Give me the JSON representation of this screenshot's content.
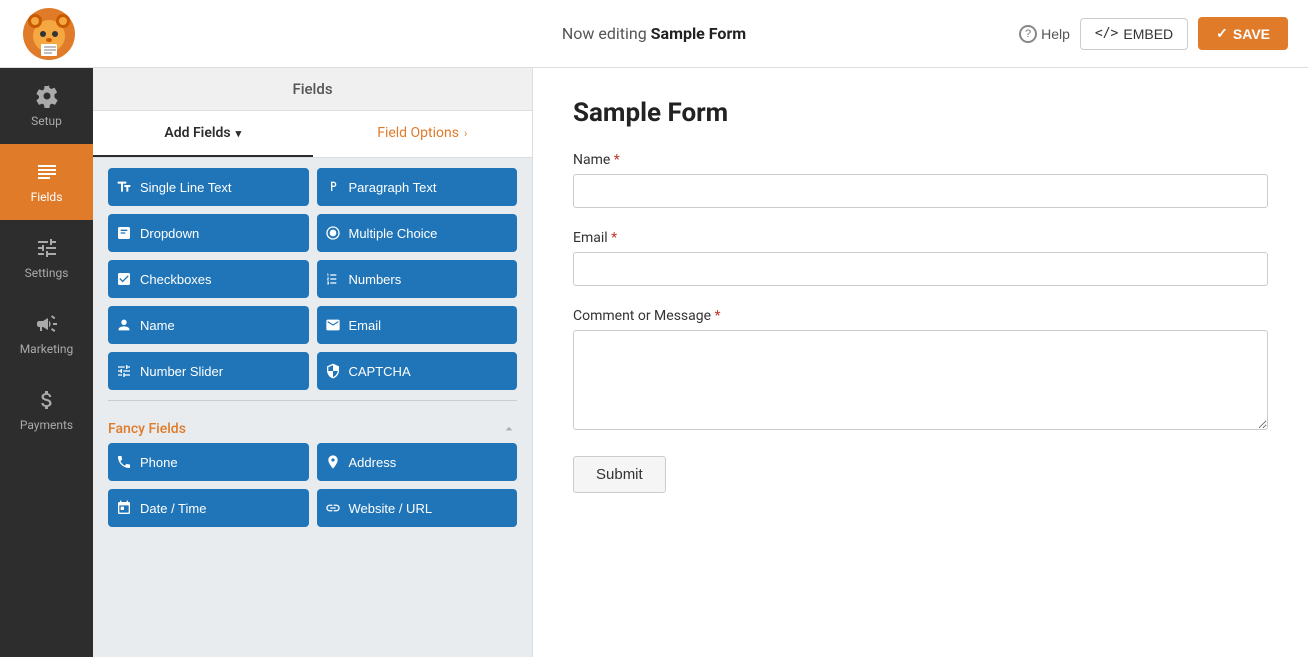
{
  "topbar": {
    "editing_prefix": "Now editing ",
    "form_name": "Sample Form",
    "help_label": "Help",
    "embed_label": "EMBED",
    "save_label": "SAVE"
  },
  "sidebar": {
    "items": [
      {
        "id": "setup",
        "label": "Setup",
        "icon": "gear"
      },
      {
        "id": "fields",
        "label": "Fields",
        "icon": "fields",
        "active": true
      },
      {
        "id": "settings",
        "label": "Settings",
        "icon": "sliders"
      },
      {
        "id": "marketing",
        "label": "Marketing",
        "icon": "megaphone"
      },
      {
        "id": "payments",
        "label": "Payments",
        "icon": "dollar"
      }
    ]
  },
  "fields_panel": {
    "header": "Fields",
    "tabs": [
      {
        "id": "add-fields",
        "label": "Add Fields",
        "active": true
      },
      {
        "id": "field-options",
        "label": "Field Options",
        "active": false,
        "color": "orange"
      }
    ],
    "standard_buttons": [
      {
        "id": "single-line-text",
        "label": "Single Line Text",
        "icon": "text"
      },
      {
        "id": "paragraph-text",
        "label": "Paragraph Text",
        "icon": "paragraph"
      },
      {
        "id": "dropdown",
        "label": "Dropdown",
        "icon": "dropdown"
      },
      {
        "id": "multiple-choice",
        "label": "Multiple Choice",
        "icon": "radio"
      },
      {
        "id": "checkboxes",
        "label": "Checkboxes",
        "icon": "checkbox"
      },
      {
        "id": "numbers",
        "label": "Numbers",
        "icon": "hash"
      },
      {
        "id": "name",
        "label": "Name",
        "icon": "person"
      },
      {
        "id": "email",
        "label": "Email",
        "icon": "envelope"
      },
      {
        "id": "number-slider",
        "label": "Number Slider",
        "icon": "sliders"
      },
      {
        "id": "captcha",
        "label": "CAPTCHA",
        "icon": "shield"
      }
    ],
    "fancy_section": {
      "label": "Fancy Fields",
      "buttons": [
        {
          "id": "phone",
          "label": "Phone",
          "icon": "phone"
        },
        {
          "id": "address",
          "label": "Address",
          "icon": "location"
        },
        {
          "id": "date-time",
          "label": "Date / Time",
          "icon": "calendar"
        },
        {
          "id": "website-url",
          "label": "Website / URL",
          "icon": "link"
        }
      ]
    }
  },
  "form": {
    "title": "Sample Form",
    "fields": [
      {
        "id": "name",
        "label": "Name",
        "required": true,
        "type": "text"
      },
      {
        "id": "email",
        "label": "Email",
        "required": true,
        "type": "text"
      },
      {
        "id": "comment",
        "label": "Comment or Message",
        "required": true,
        "type": "textarea"
      }
    ],
    "submit_label": "Submit"
  }
}
